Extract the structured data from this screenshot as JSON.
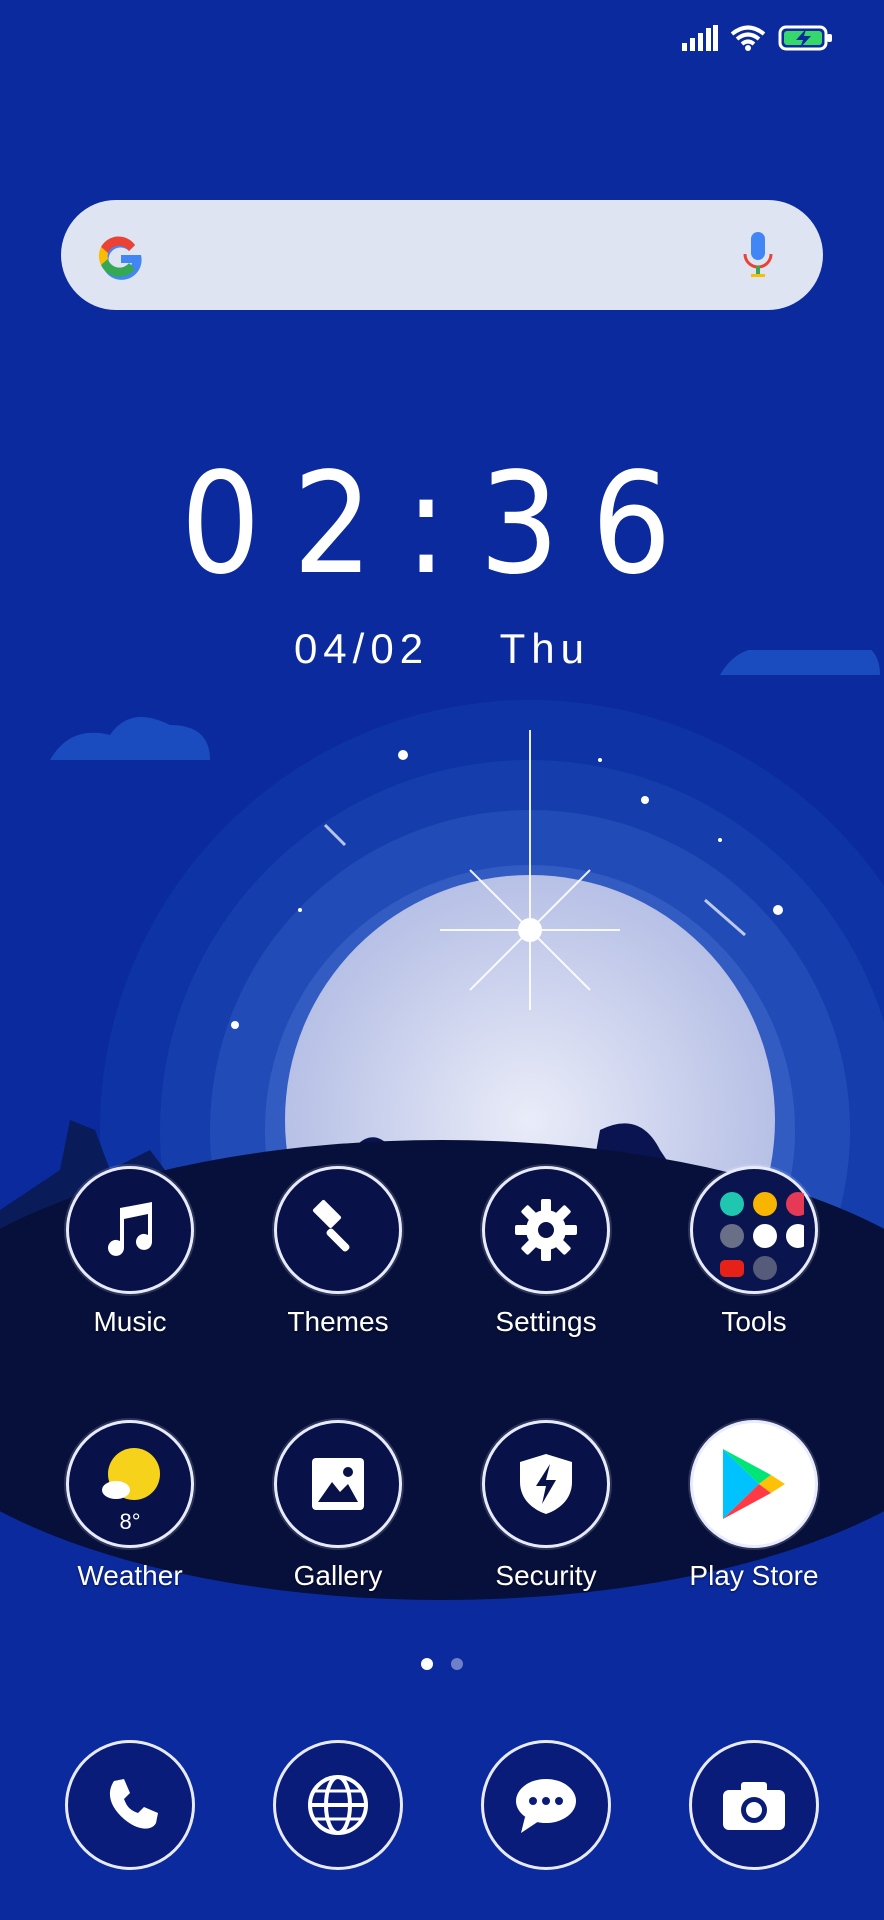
{
  "status_bar": {
    "icons": [
      "signal-icon",
      "wifi-icon",
      "battery-charging-icon"
    ]
  },
  "search": {
    "placeholder": "",
    "icons": [
      "google-logo-icon",
      "mic-icon"
    ]
  },
  "clock": {
    "time": "02:36",
    "date": "04/02",
    "day": "Thu"
  },
  "apps_row1": [
    {
      "label": "Music",
      "icon": "music-note-icon"
    },
    {
      "label": "Themes",
      "icon": "paintbrush-icon"
    },
    {
      "label": "Settings",
      "icon": "gear-icon"
    },
    {
      "label": "Tools",
      "icon": "folder-icon"
    }
  ],
  "apps_row2": [
    {
      "label": "Weather",
      "icon": "sun-cloud-icon",
      "temp": "8°"
    },
    {
      "label": "Gallery",
      "icon": "image-icon"
    },
    {
      "label": "Security",
      "icon": "shield-bolt-icon"
    },
    {
      "label": "Play Store",
      "icon": "play-store-icon"
    }
  ],
  "page_indicator": {
    "current": 1,
    "total": 2
  },
  "dock": [
    {
      "icon": "phone-icon"
    },
    {
      "icon": "globe-icon"
    },
    {
      "icon": "message-icon"
    },
    {
      "icon": "camera-icon"
    }
  ],
  "colors": {
    "background": "#0b2a9e",
    "search_bg": "#dfe4f3",
    "icon_circle": "#081248",
    "moon": "#cdd3ee"
  }
}
